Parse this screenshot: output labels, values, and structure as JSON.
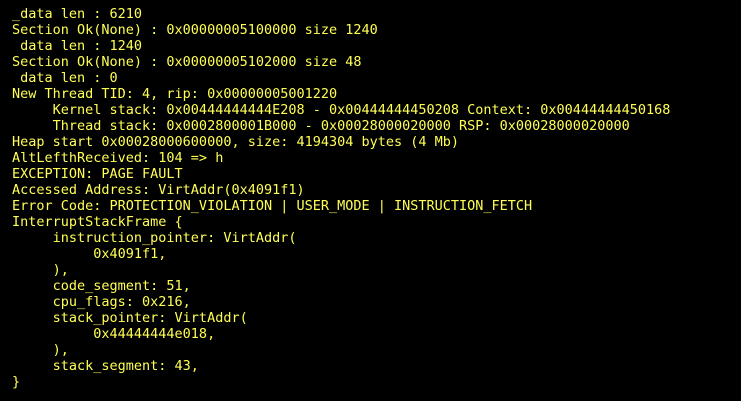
{
  "console": {
    "text_color": "#ffff55",
    "background_color": "#000000",
    "lines": [
      "_data len : 6210",
      "Section Ok(None) : 0x00000005100000 size 1240",
      " data len : 1240",
      "Section Ok(None) : 0x00000005102000 size 48",
      " data len : 0",
      "New Thread TID: 4, rip: 0x00000005001220",
      "     Kernel stack: 0x00444444444E208 - 0x00444444450208 Context: 0x00444444450168",
      "     Thread stack: 0x0002800001B000 - 0x00028000020000 RSP: 0x00028000020000",
      "Heap start 0x00028000600000, size: 4194304 bytes (4 Mb)",
      "AltLefthReceived: 104 => h",
      "EXCEPTION: PAGE FAULT",
      "Accessed Address: VirtAddr(0x4091f1)",
      "Error Code: PROTECTION_VIOLATION | USER_MODE | INSTRUCTION_FETCH",
      "InterruptStackFrame {",
      "     instruction_pointer: VirtAddr(",
      "          0x4091f1,",
      "     ),",
      "     code_segment: 51,",
      "     cpu_flags: 0x216,",
      "     stack_pointer: VirtAddr(",
      "          0x44444444e018,",
      "     ),",
      "     stack_segment: 43,",
      "}"
    ]
  }
}
